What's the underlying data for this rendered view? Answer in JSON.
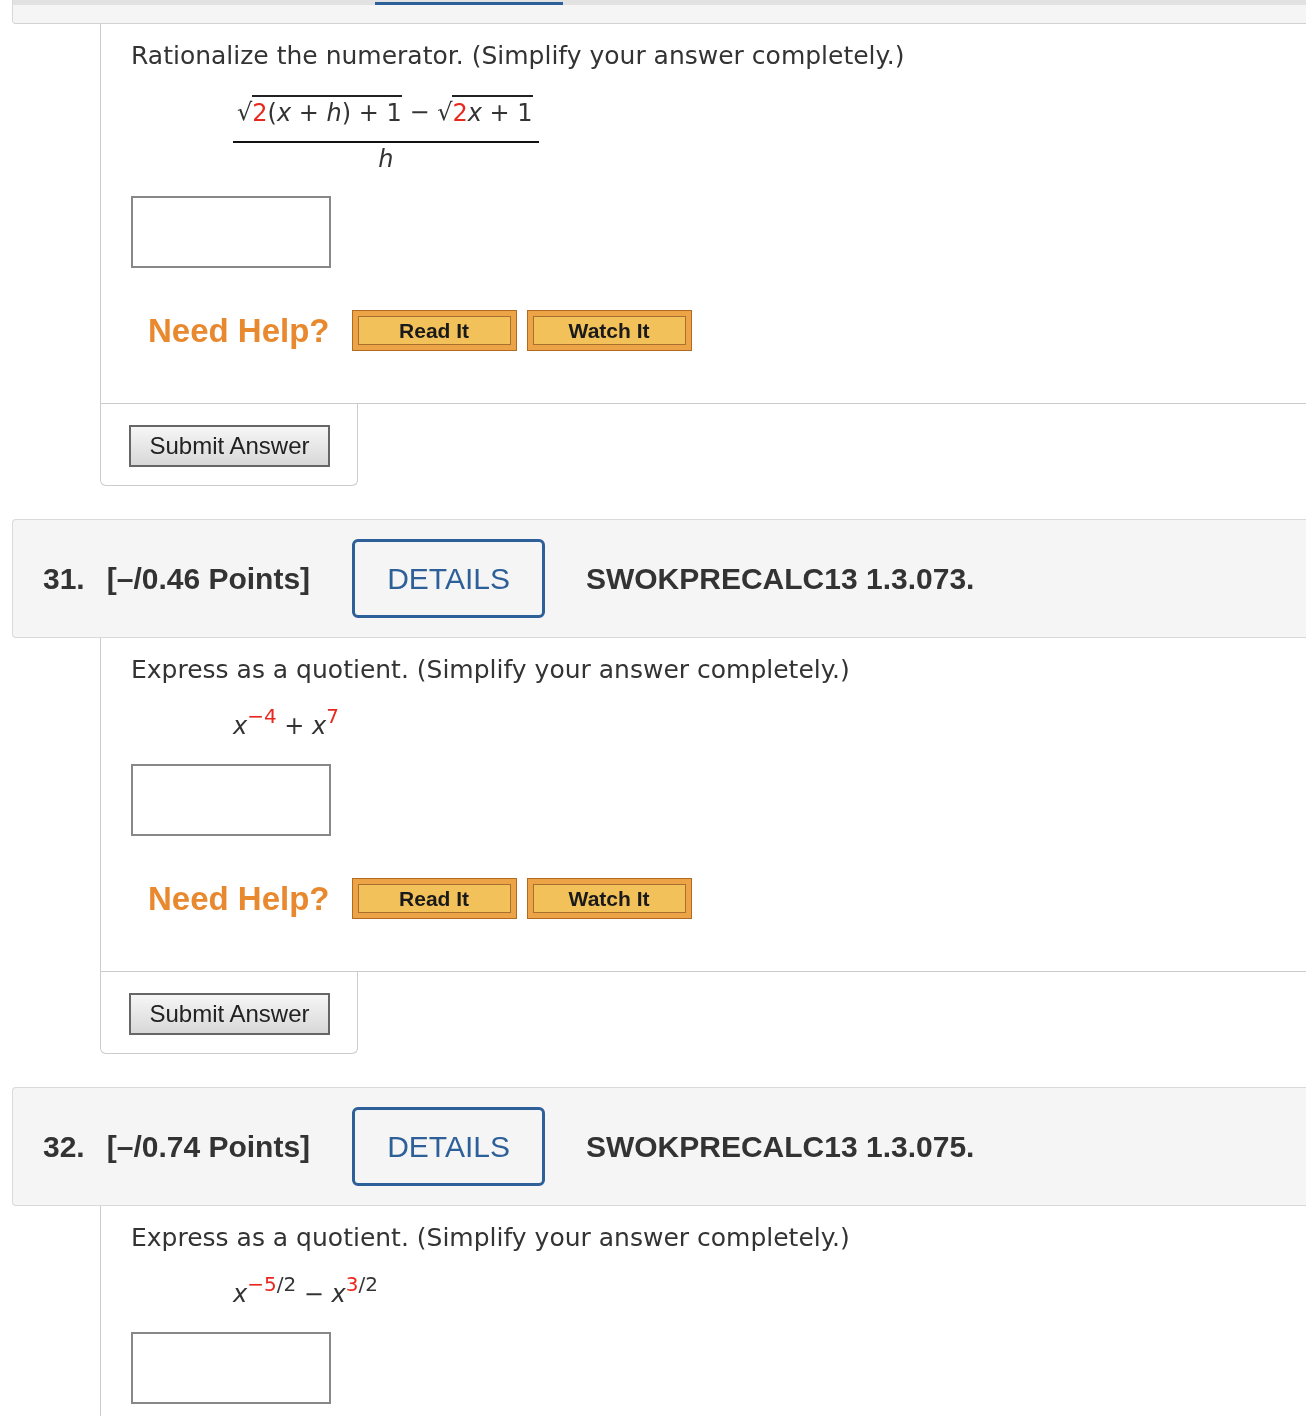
{
  "questions": [
    {
      "header": {
        "cut_off": true
      },
      "prompt": "Rationalize the numerator. (Simplify your answer completely.)",
      "expression": [
        {
          "kind": "frac",
          "numerator": [
            {
              "kind": "sqrt",
              "sign": "√",
              "radicand": [
                {
                  "kind": "param",
                  "text": "2"
                },
                {
                  "kind": "plain",
                  "text": "("
                },
                {
                  "kind": "var",
                  "text": "x"
                },
                {
                  "kind": "plain",
                  "text": " + "
                },
                {
                  "kind": "var",
                  "text": "h"
                },
                {
                  "kind": "plain",
                  "text": ") + 1"
                }
              ]
            },
            {
              "kind": "plain",
              "text": " − "
            },
            {
              "kind": "sqrt",
              "sign": "√",
              "radicand": [
                {
                  "kind": "param",
                  "text": "2"
                },
                {
                  "kind": "var",
                  "text": "x"
                },
                {
                  "kind": "plain",
                  "text": " + 1"
                }
              ]
            }
          ],
          "denominator": [
            {
              "kind": "var",
              "text": "h"
            }
          ]
        }
      ],
      "help": {
        "label": "Need Help?",
        "buttons": [
          "Read It",
          "Watch It"
        ]
      },
      "submit": "Submit Answer"
    },
    {
      "header": {
        "cut_off": false,
        "number": "31.",
        "points": "[–/0.46 Points]",
        "details": "DETAILS",
        "code": "SWOKPRECALC13 1.3.073."
      },
      "prompt": "Express as a quotient. (Simplify your answer completely.)",
      "expression": [
        {
          "kind": "var",
          "text": "x"
        },
        {
          "kind": "sup",
          "children": [
            {
              "kind": "param",
              "text": "−4"
            }
          ]
        },
        {
          "kind": "plain",
          "text": " + "
        },
        {
          "kind": "var",
          "text": "x"
        },
        {
          "kind": "sup",
          "children": [
            {
              "kind": "param",
              "text": "7"
            }
          ]
        }
      ],
      "help": {
        "label": "Need Help?",
        "buttons": [
          "Read It",
          "Watch It"
        ]
      },
      "submit": "Submit Answer"
    },
    {
      "header": {
        "cut_off": false,
        "number": "32.",
        "points": "[–/0.74 Points]",
        "details": "DETAILS",
        "code": "SWOKPRECALC13 1.3.075."
      },
      "prompt": "Express as a quotient. (Simplify your answer completely.)",
      "expression": [
        {
          "kind": "var",
          "text": "x"
        },
        {
          "kind": "sup",
          "children": [
            {
              "kind": "param",
              "text": "−5"
            },
            {
              "kind": "plain",
              "text": "/2"
            }
          ]
        },
        {
          "kind": "plain",
          "text": " − "
        },
        {
          "kind": "var",
          "text": "x"
        },
        {
          "kind": "sup",
          "children": [
            {
              "kind": "param",
              "text": "3"
            },
            {
              "kind": "plain",
              "text": "/2"
            }
          ]
        }
      ]
    }
  ]
}
